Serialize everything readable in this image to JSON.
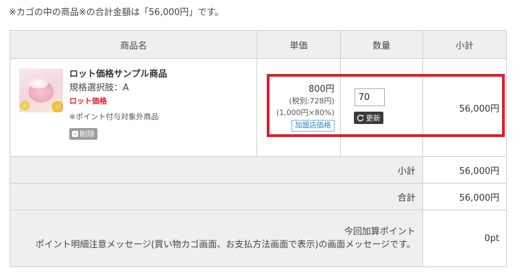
{
  "summary": {
    "text": "※カゴの中の商品※の合計金額は「56,000円」です。"
  },
  "table": {
    "headers": [
      "商品名",
      "単価",
      "数量",
      "小計"
    ]
  },
  "item": {
    "thumbnail_icon": "cream-jar-photo",
    "title": "ロット価格サンプル商品",
    "spec": "規格選択肢：A",
    "lot_label": "ロット価格",
    "point_note": "※ポイント付与対象外商品",
    "delete_label": "削除",
    "price": "800円",
    "price_tax": "(税別:728円)",
    "price_calc": "(1,000円×80%)",
    "price_badge": "加盟店価格",
    "quantity": "70",
    "update_label": "更新",
    "subtotal": "56,000円"
  },
  "totals": {
    "subtotal_label": "小計",
    "subtotal_value": "56,000円",
    "total_label": "合計",
    "total_value": "56,000円",
    "points_label_line1": "今回加算ポイント",
    "points_message": "ポイント明細注意メッセージ(買い物カゴ画面、お支払方法画面で表示)の画面メッセージです。",
    "points_value": "0pt"
  },
  "colors": {
    "highlight": "#e21b2d",
    "lot_price": "#e0202a",
    "badge": "#2e86c1"
  }
}
